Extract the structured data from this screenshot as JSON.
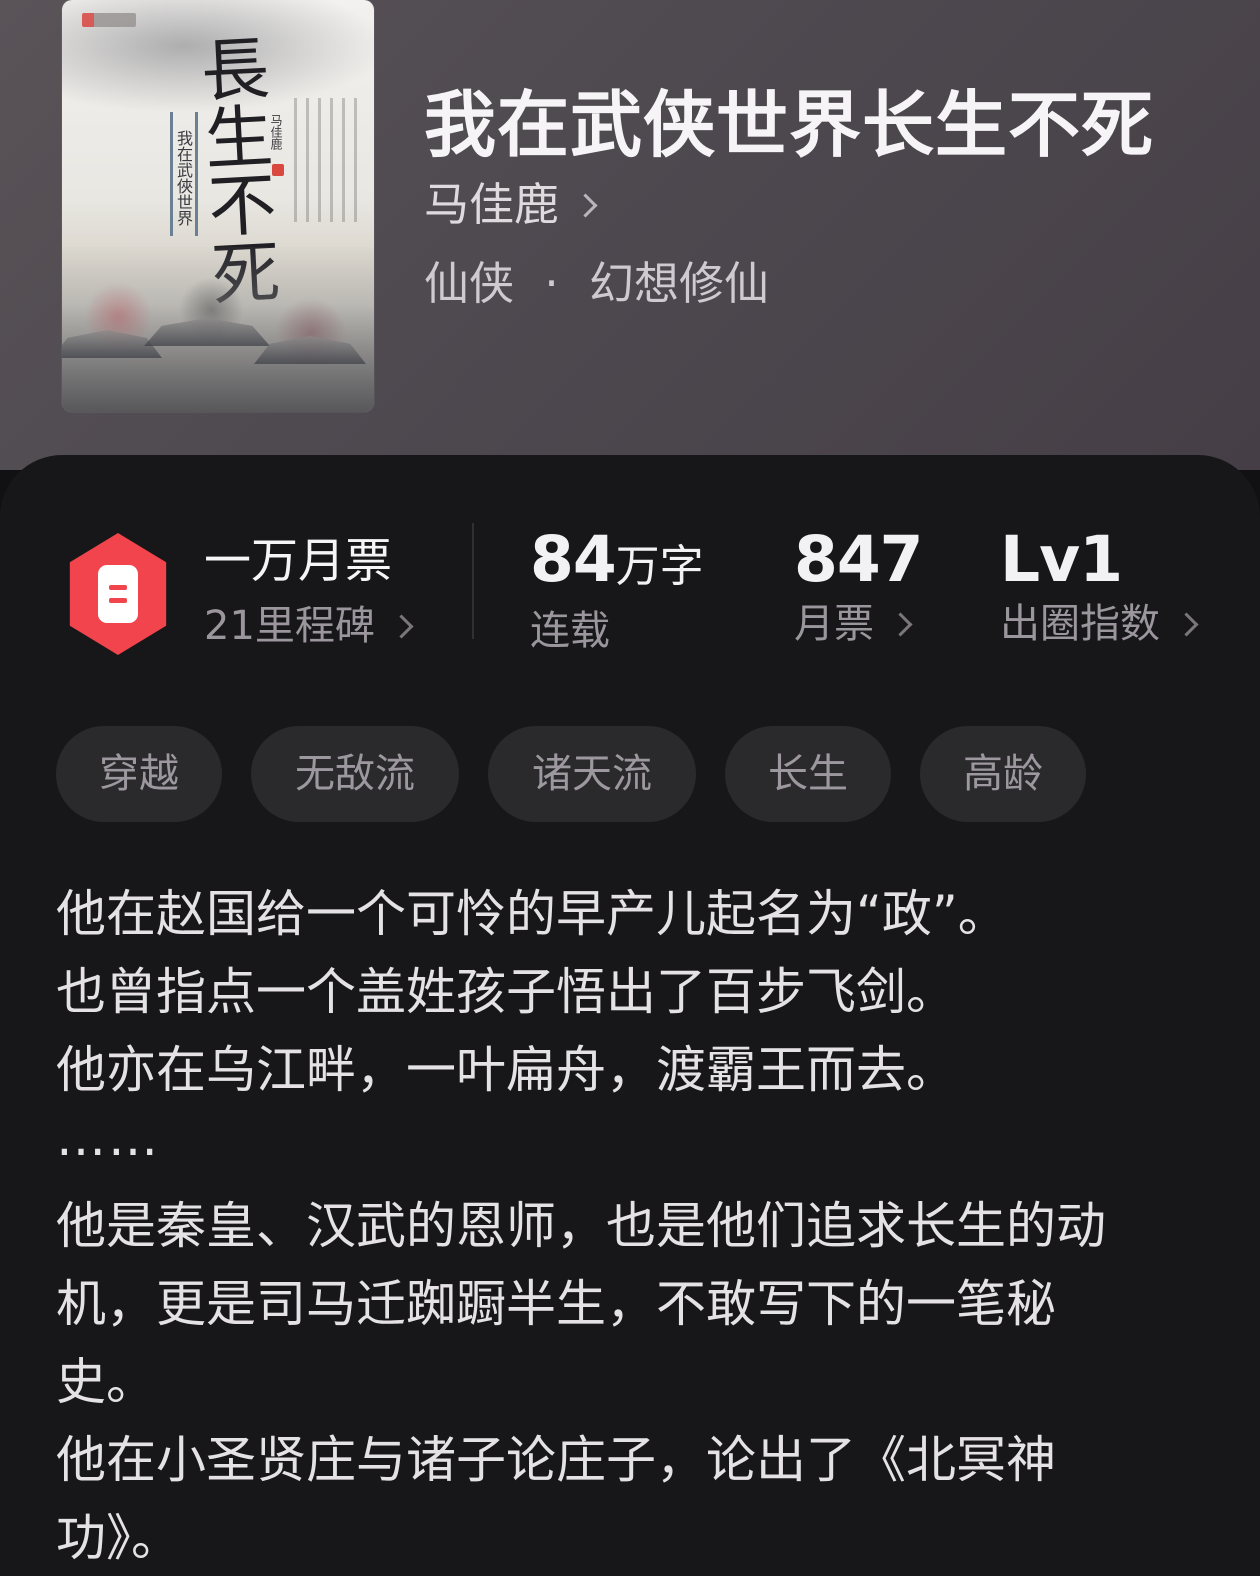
{
  "book": {
    "title": "我在武侠世界长生不死",
    "author": "马佳鹿",
    "category_main": "仙侠",
    "category_separator": "·",
    "category_sub": "幻想修仙",
    "cover": {
      "title": "長生不死",
      "subtitle": "我在武俠世界",
      "author": "马佳鹿",
      "publisher_logo": "点众文学"
    }
  },
  "stats": {
    "milestone": {
      "title": "一万月票",
      "subtitle": "21里程碑",
      "icon": "monthly-ticket-icon",
      "color": "#f2444c"
    },
    "words": {
      "value": "84",
      "unit": "万字",
      "label": "连载"
    },
    "monthly_tickets": {
      "value": "847",
      "label": "月票"
    },
    "circle_index": {
      "value": "Lv1",
      "label": "出圈指数"
    }
  },
  "tags": [
    "穿越",
    "无敌流",
    "诸天流",
    "长生",
    "高龄"
  ],
  "synopsis": {
    "lines": [
      "他在赵国给一个可怜的早产儿起名为“政”。",
      "也曾指点一个盖姓孩子悟出了百步飞剑。",
      "他亦在乌江畔，一叶扁舟，渡霸王而去。",
      "……",
      "他是秦皇、汉武的恩师，也是他们追求长生的动",
      "机，更是司马迁踟蹰半生，不敢写下的一笔秘",
      "史。",
      "他在小圣贤庄与诸子论庄子，论出了《北冥神",
      "功》。"
    ]
  }
}
